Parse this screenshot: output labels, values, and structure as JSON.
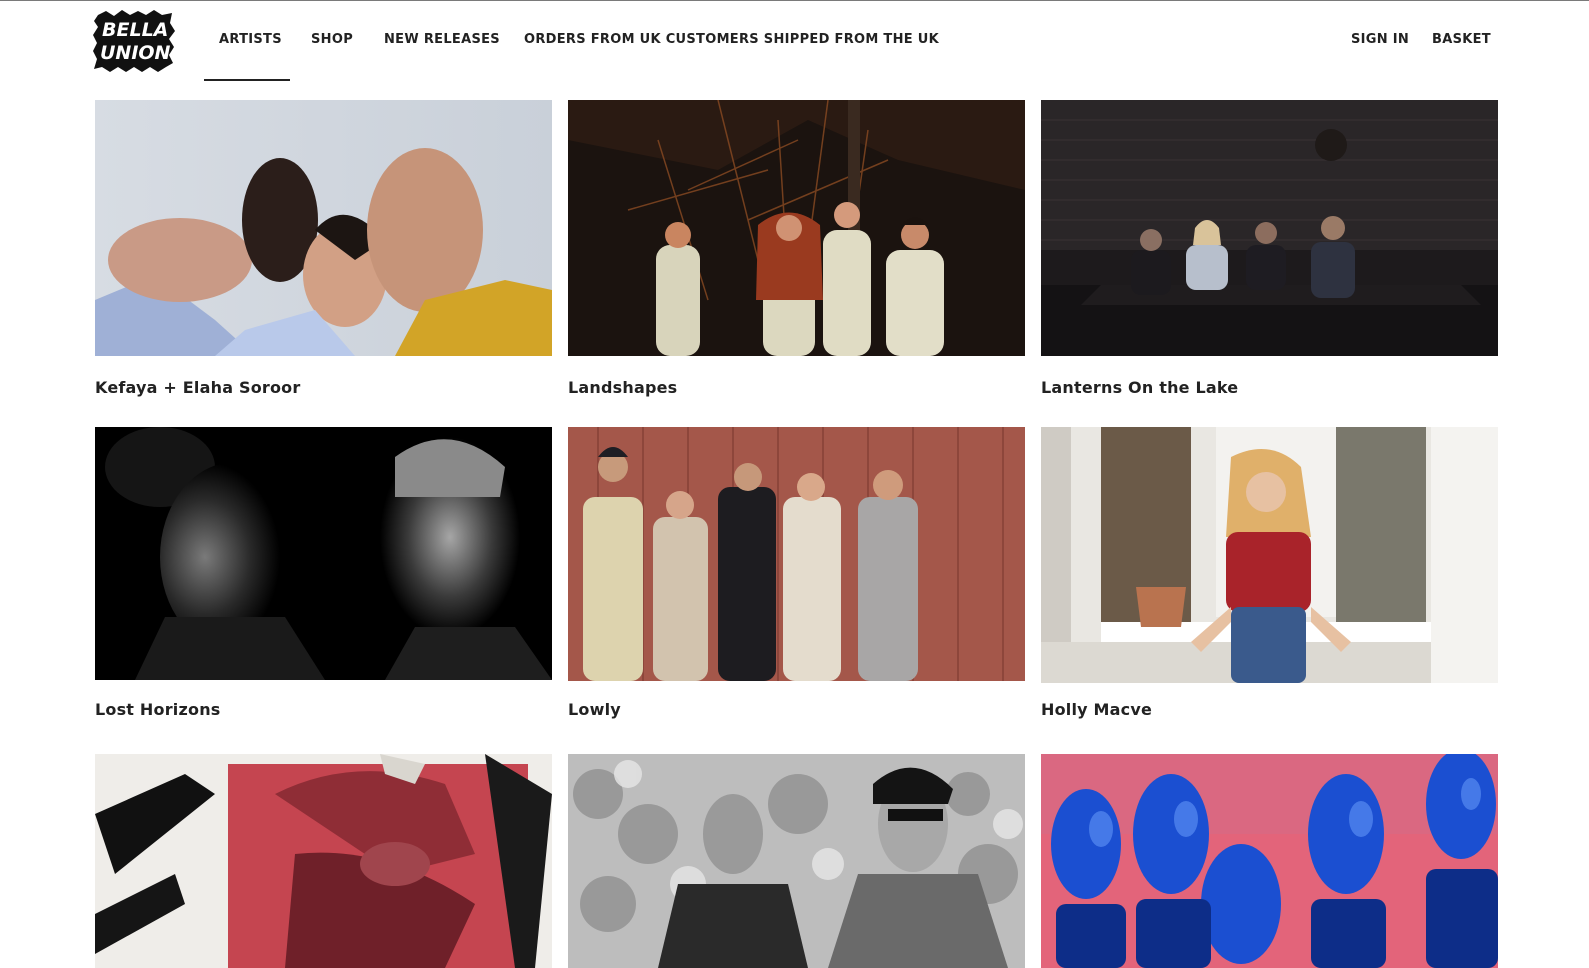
{
  "brand": {
    "logo_text_top": "BELLA",
    "logo_text_bottom": "UNION"
  },
  "nav": {
    "items": [
      {
        "label": "ARTISTS",
        "active": true
      },
      {
        "label": "SHOP"
      },
      {
        "label": "NEW RELEASES"
      },
      {
        "label": "ORDERS FROM UK CUSTOMERS SHIPPED FROM THE UK"
      }
    ],
    "sign_in": "SIGN IN",
    "basket": "BASKET"
  },
  "artists": [
    {
      "name": "Kefaya + Elaha Soroor"
    },
    {
      "name": "Landshapes"
    },
    {
      "name": "Lanterns On the Lake"
    },
    {
      "name": "Lost Horizons"
    },
    {
      "name": "Lowly"
    },
    {
      "name": "Holly Macve"
    },
    {
      "name": ""
    },
    {
      "name": ""
    },
    {
      "name": ""
    }
  ]
}
